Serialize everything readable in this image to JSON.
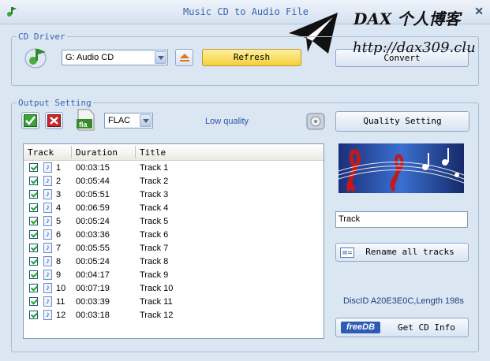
{
  "window": {
    "title": "Music CD to Audio File"
  },
  "watermark": {
    "line1": "DAX 个人博客",
    "line2": "http://dax309.clu"
  },
  "cd_driver": {
    "legend": "CD Driver",
    "drive_value": "G: Audio CD",
    "refresh_label": "Refresh",
    "convert_label": "Convert"
  },
  "output": {
    "legend": "Output Setting",
    "format_value": "FLAC",
    "format_icon_text": "fla",
    "quality_text": "Low quality",
    "quality_setting_label": "Quality Setting",
    "track_name_value": "Track",
    "rename_label": "Rename all tracks",
    "disc_info": "DiscID A20E3E0C,Length 198s",
    "freedb_logo": "freeDB",
    "get_cd_info_label": "Get CD Info"
  },
  "table": {
    "headers": {
      "track": "Track",
      "duration": "Duration",
      "title": "Title"
    },
    "rows": [
      {
        "num": "1",
        "dur": "00:03:15",
        "title": "Track 1"
      },
      {
        "num": "2",
        "dur": "00:05:44",
        "title": "Track 2"
      },
      {
        "num": "3",
        "dur": "00:05:51",
        "title": "Track 3"
      },
      {
        "num": "4",
        "dur": "00:06:59",
        "title": "Track 4"
      },
      {
        "num": "5",
        "dur": "00:05:24",
        "title": "Track 5"
      },
      {
        "num": "6",
        "dur": "00:03:36",
        "title": "Track 6"
      },
      {
        "num": "7",
        "dur": "00:05:55",
        "title": "Track 7"
      },
      {
        "num": "8",
        "dur": "00:05:24",
        "title": "Track 8"
      },
      {
        "num": "9",
        "dur": "00:04:17",
        "title": "Track 9"
      },
      {
        "num": "10",
        "dur": "00:07:19",
        "title": "Track 10"
      },
      {
        "num": "11",
        "dur": "00:03:39",
        "title": "Track 11"
      },
      {
        "num": "12",
        "dur": "00:03:18",
        "title": "Track 12"
      }
    ]
  },
  "colors": {
    "accent": "#3a64b0",
    "refresh_bg": "#fde25a",
    "background": "#dbe6f3"
  }
}
